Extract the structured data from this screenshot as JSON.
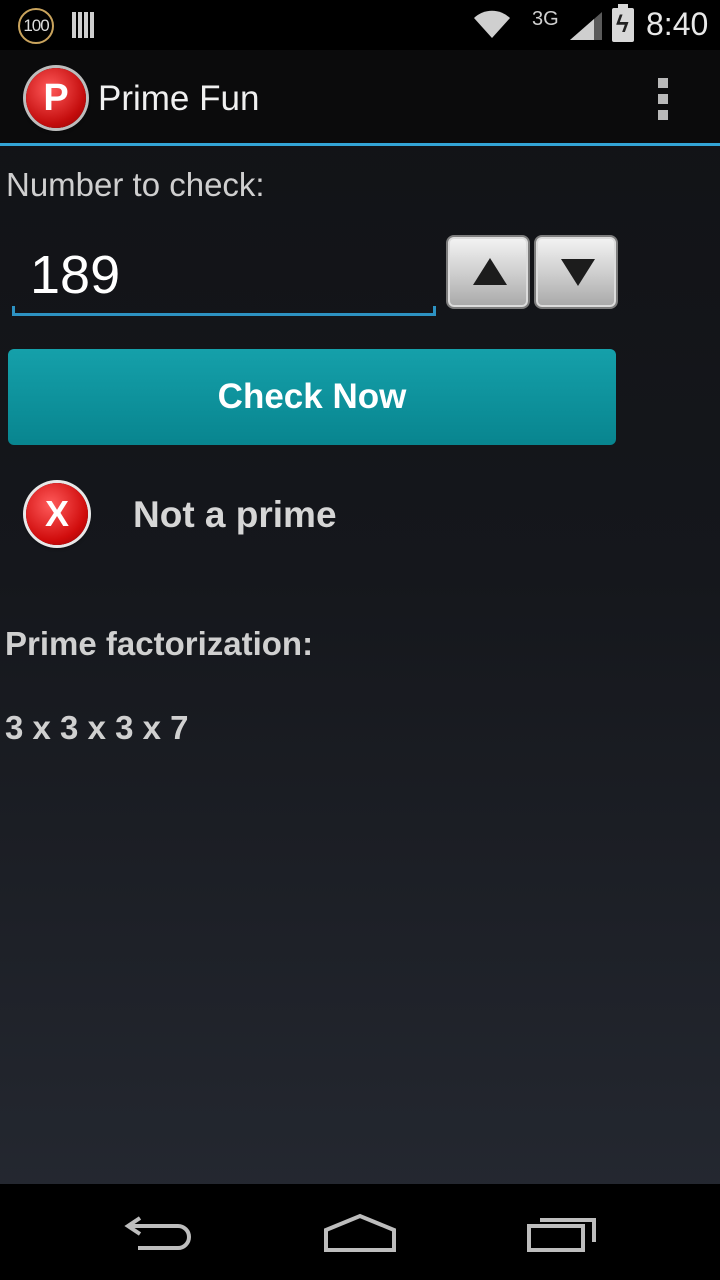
{
  "status_bar": {
    "notification_badge": "100",
    "network_type": "3G",
    "time": "8:40",
    "icons": [
      "notification-count-icon",
      "barcode-icon",
      "wifi-icon",
      "signal-icon",
      "battery-charging-icon"
    ]
  },
  "action_bar": {
    "logo_letter": "P",
    "title": "Prime Fun",
    "menu_icon": "overflow-menu-icon"
  },
  "form": {
    "number_label": "Number to check:",
    "number_value": "189",
    "increment_icon": "triangle-up-icon",
    "decrement_icon": "triangle-down-icon",
    "check_button_label": "Check Now"
  },
  "result": {
    "icon": "red-x-icon",
    "icon_glyph": "X",
    "text": "Not a prime",
    "factorization_label": "Prime factorization:",
    "factorization_value": "3 x 3 x 3 x 7"
  },
  "nav_bar": {
    "icons": [
      "back-icon",
      "home-icon",
      "recent-apps-icon"
    ]
  },
  "colors": {
    "accent": "#33a4d6",
    "button": "#0f939d",
    "error": "#d00c0c"
  }
}
